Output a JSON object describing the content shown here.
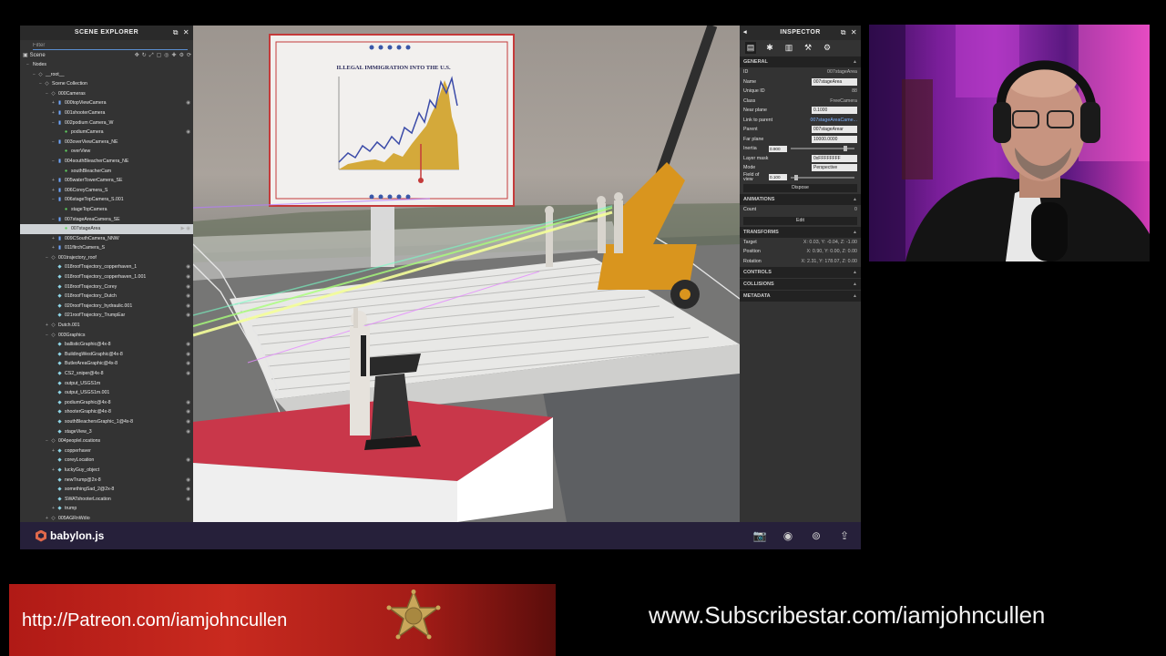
{
  "explorer": {
    "title": "SCENE EXPLORER",
    "filter_placeholder": "Filter",
    "scene_label": "Scene",
    "tree": [
      {
        "label": "Nodes",
        "depth": 1,
        "kind": "none",
        "exp": "−"
      },
      {
        "label": "__root__",
        "depth": 2,
        "kind": "node",
        "exp": "−"
      },
      {
        "label": "Scene Collection",
        "depth": 3,
        "kind": "node",
        "exp": "−"
      },
      {
        "label": "000Cameras",
        "depth": 4,
        "kind": "node",
        "exp": "−"
      },
      {
        "label": "000topViewCamera",
        "depth": 5,
        "kind": "cam",
        "exp": "+",
        "eye": true
      },
      {
        "label": "001shooterCamera",
        "depth": 5,
        "kind": "cam",
        "exp": "+"
      },
      {
        "label": "002podium Camera_W",
        "depth": 5,
        "kind": "cam",
        "exp": "−"
      },
      {
        "label": "podiumCamera",
        "depth": 6,
        "kind": "green",
        "exp": "",
        "eye": true
      },
      {
        "label": "003overViewCamera_NE",
        "depth": 5,
        "kind": "cam",
        "exp": "−"
      },
      {
        "label": "overView",
        "depth": 6,
        "kind": "green",
        "exp": ""
      },
      {
        "label": "004southBleacherCamera_NE",
        "depth": 5,
        "kind": "cam",
        "exp": "−"
      },
      {
        "label": "southBleacherCam",
        "depth": 6,
        "kind": "green",
        "exp": ""
      },
      {
        "label": "005waterTowerCamera_SE",
        "depth": 5,
        "kind": "cam",
        "exp": "+"
      },
      {
        "label": "006CoreyCamera_S",
        "depth": 5,
        "kind": "cam",
        "exp": "+"
      },
      {
        "label": "006stageTopCamera_S.001",
        "depth": 5,
        "kind": "cam",
        "exp": "−"
      },
      {
        "label": "stageTopCamera",
        "depth": 6,
        "kind": "green",
        "exp": ""
      },
      {
        "label": "007stageAreaCamera_SE",
        "depth": 5,
        "kind": "cam",
        "exp": "−"
      },
      {
        "label": "007stageArea",
        "depth": 6,
        "kind": "green",
        "exp": "",
        "selected": true,
        "eye": true
      },
      {
        "label": "009CSouthCamera_NNW",
        "depth": 5,
        "kind": "cam",
        "exp": "+"
      },
      {
        "label": "011flirchCamera_S",
        "depth": 5,
        "kind": "cam",
        "exp": "+"
      },
      {
        "label": "001trajectory_roof",
        "depth": 4,
        "kind": "node",
        "exp": "−"
      },
      {
        "label": "018roofTrajectory_copperhaven_1",
        "depth": 5,
        "kind": "mesh",
        "exp": "",
        "eye": true
      },
      {
        "label": "018roofTrajectory_copperhaven_1.001",
        "depth": 5,
        "kind": "mesh",
        "exp": "",
        "eye": true
      },
      {
        "label": "018roofTrajectory_Corey",
        "depth": 5,
        "kind": "mesh",
        "exp": "",
        "eye": true
      },
      {
        "label": "018roofTrajectory_Dutch",
        "depth": 5,
        "kind": "mesh",
        "exp": "",
        "eye": true
      },
      {
        "label": "020roofTrajectory_hydraulic.001",
        "depth": 5,
        "kind": "mesh",
        "exp": "",
        "eye": true
      },
      {
        "label": "021roofTrajectory_TrumpEar",
        "depth": 5,
        "kind": "mesh",
        "exp": "",
        "eye": true
      },
      {
        "label": "Dutch.001",
        "depth": 4,
        "kind": "node",
        "exp": "+"
      },
      {
        "label": "003Graphics",
        "depth": 4,
        "kind": "node",
        "exp": "−"
      },
      {
        "label": "ballisticGraphic@4x-8",
        "depth": 5,
        "kind": "mesh",
        "exp": "",
        "eye": true
      },
      {
        "label": "BuildingWestGraphic@4x-8",
        "depth": 5,
        "kind": "mesh",
        "exp": "",
        "eye": true
      },
      {
        "label": "ButlerAreaGraphic@4x-8",
        "depth": 5,
        "kind": "mesh",
        "exp": "",
        "eye": true
      },
      {
        "label": "CS2_sniper@4x-8",
        "depth": 5,
        "kind": "mesh",
        "exp": "",
        "eye": true
      },
      {
        "label": "output_USGS1m",
        "depth": 5,
        "kind": "mesh",
        "exp": ""
      },
      {
        "label": "output_USGS1m.001",
        "depth": 5,
        "kind": "mesh",
        "exp": ""
      },
      {
        "label": "podiumGraphic@4x-8",
        "depth": 5,
        "kind": "mesh",
        "exp": "",
        "eye": true
      },
      {
        "label": "shooterGraphic@4x-8",
        "depth": 5,
        "kind": "mesh",
        "exp": "",
        "eye": true
      },
      {
        "label": "southBleachersGraphic_1@4x-8",
        "depth": 5,
        "kind": "mesh",
        "exp": "",
        "eye": true
      },
      {
        "label": "stageView_3",
        "depth": 5,
        "kind": "mesh",
        "exp": "",
        "eye": true
      },
      {
        "label": "004peoplel.ocations",
        "depth": 4,
        "kind": "node",
        "exp": "−"
      },
      {
        "label": "copperhaver",
        "depth": 5,
        "kind": "mesh",
        "exp": "+"
      },
      {
        "label": "coreyLocation",
        "depth": 5,
        "kind": "mesh",
        "exp": "",
        "eye": true
      },
      {
        "label": "luckyGuy_object",
        "depth": 5,
        "kind": "mesh",
        "exp": "+"
      },
      {
        "label": "newTrump@2x-8",
        "depth": 5,
        "kind": "mesh",
        "exp": "",
        "eye": true
      },
      {
        "label": "somethingSad_2@2x-8",
        "depth": 5,
        "kind": "mesh",
        "exp": "",
        "eye": true
      },
      {
        "label": "SWATshooterLocation",
        "depth": 5,
        "kind": "mesh",
        "exp": "",
        "eye": true
      },
      {
        "label": "trump",
        "depth": 5,
        "kind": "mesh",
        "exp": "+"
      },
      {
        "label": "005AGRnWdio",
        "depth": 4,
        "kind": "node",
        "exp": "+"
      }
    ]
  },
  "billboard": {
    "title": "ILLEGAL IMMIGRATION INTO THE U.S."
  },
  "inspector": {
    "title": "INSPECTOR",
    "general_label": "GENERAL",
    "props": {
      "id_label": "ID",
      "id_value": "007stageArea",
      "name_label": "Name",
      "name_value": "007stageArea",
      "unique_label": "Unique ID",
      "unique_value": "88",
      "class_label": "Class",
      "class_value": "FreeCamera",
      "near_label": "Near plane",
      "near_value": "0.1000",
      "link_label": "Link to parent",
      "link_value": "007stageAreaCame...",
      "parent_label": "Parent",
      "parent_value": "007stageArear",
      "far_label": "Far plane",
      "far_value": "10000.0000",
      "inertia_label": "Inertia",
      "inertia_value": "0.900",
      "layer_label": "Layer mask",
      "layer_value": "0xFFFFFFFF",
      "mode_label": "Mode",
      "mode_value": "Perspective",
      "fov_label": "Field of view",
      "fov_value": "0.100",
      "dispose_label": "Dispose"
    },
    "animations_label": "ANIMATIONS",
    "count_label": "Count",
    "count_value": "0",
    "edit_label": "Edit",
    "transforms_label": "TRANSFORMS",
    "target_label": "Target",
    "target_value": "X: 0.03, Y: -0.04, Z: -1.00",
    "position_label": "Position",
    "position_value": "X: 0.90, Y: 0.00, Z: 0.00",
    "rotation_label": "Rotation",
    "rotation_value": "X: 2.31, Y: 178.07, Z: 0.00",
    "controls_label": "CONTROLS",
    "collisions_label": "COLLISIONS",
    "metadata_label": "METADATA"
  },
  "statusbar": {
    "brand": "babylon.js"
  },
  "banners": {
    "patreon": "http://Patreon.com/iamjohncullen",
    "subscribestar": "www.Subscribestar.com/iamjohncullen"
  },
  "colors": {
    "accent": "#5b8fd1",
    "statusbar": "#26203a",
    "patreon_red": "#c92a1f",
    "stage_red": "#c9374a"
  }
}
